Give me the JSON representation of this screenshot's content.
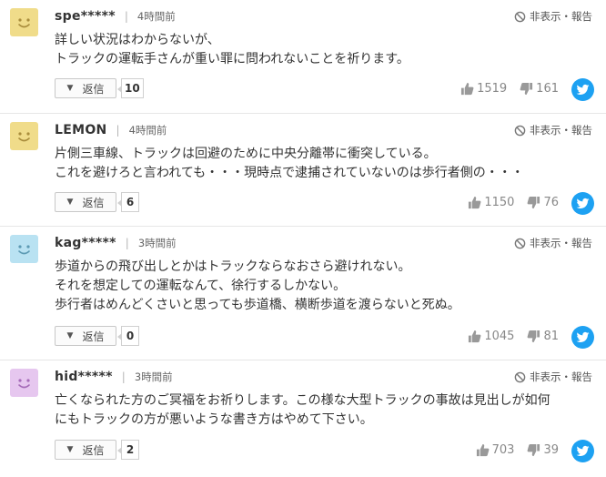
{
  "labels": {
    "reply": "返信",
    "report": "非表示・報告"
  },
  "colors": {
    "twitter": "#1da1f2",
    "avatar_yellow": "#f0dc8a",
    "avatar_blue": "#b9e2f2",
    "avatar_purple": "#e6c7ef"
  },
  "comments": [
    {
      "user": "spe*****",
      "time": "4時間前",
      "avatar_color": "yellow",
      "text": "詳しい状況はわからないが、\nトラックの運転手さんが重い罪に問われないことを祈ります。",
      "reply_count": "10",
      "likes": "1519",
      "dislikes": "161"
    },
    {
      "user": "LEMON",
      "time": "4時間前",
      "avatar_color": "yellow",
      "text": "片側三車線、トラックは回避のために中央分離帯に衝突している。\nこれを避けろと言われても・・・現時点で逮捕されていないのは歩行者側の・・・",
      "reply_count": "6",
      "likes": "1150",
      "dislikes": "76"
    },
    {
      "user": "kag*****",
      "time": "3時間前",
      "avatar_color": "blue",
      "text": "歩道からの飛び出しとかはトラックならなおさら避けれない。\nそれを想定しての運転なんて、徐行するしかない。\n歩行者はめんどくさいと思っても歩道橋、横断歩道を渡らないと死ぬ。",
      "reply_count": "0",
      "likes": "1045",
      "dislikes": "81"
    },
    {
      "user": "hid*****",
      "time": "3時間前",
      "avatar_color": "purple",
      "text": "亡くなられた方のご冥福をお祈りします。この様な大型トラックの事故は見出しが如何\nにもトラックの方が悪いような書き方はやめて下さい。",
      "reply_count": "2",
      "likes": "703",
      "dislikes": "39"
    }
  ]
}
